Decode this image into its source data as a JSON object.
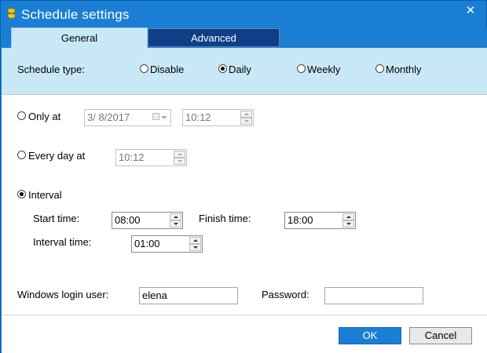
{
  "window": {
    "title": "Schedule settings",
    "close_glyph": "✕",
    "app_icon": "yellow-s-icon"
  },
  "tabs": [
    {
      "label": "General",
      "active": true
    },
    {
      "label": "Advanced",
      "active": false
    }
  ],
  "schedule_type": {
    "label": "Schedule type:",
    "options": [
      {
        "label": "Disable",
        "selected": false
      },
      {
        "label": "Daily",
        "selected": true
      },
      {
        "label": "Weekly",
        "selected": false
      },
      {
        "label": "Monthly",
        "selected": false
      }
    ]
  },
  "only_at": {
    "label": "Only at",
    "selected": false,
    "date": "3/  8/2017",
    "time": "10:12"
  },
  "every_day_at": {
    "label": "Every day at",
    "selected": false,
    "time": "10:12"
  },
  "interval": {
    "label": "Interval",
    "selected": true,
    "start_time_label": "Start time:",
    "start_time": "08:00",
    "finish_time_label": "Finish time:",
    "finish_time": "18:00",
    "interval_time_label": "Interval time:",
    "interval_time": "01:00"
  },
  "login": {
    "user_label": "Windows login user:",
    "user_value": "elena",
    "password_label": "Password:",
    "password_value": ""
  },
  "buttons": {
    "ok": "OK",
    "cancel": "Cancel"
  },
  "colors": {
    "titlebar": "#1a7fd4",
    "band": "#c9e8f7",
    "advanced_tab": "#0f3f86"
  }
}
